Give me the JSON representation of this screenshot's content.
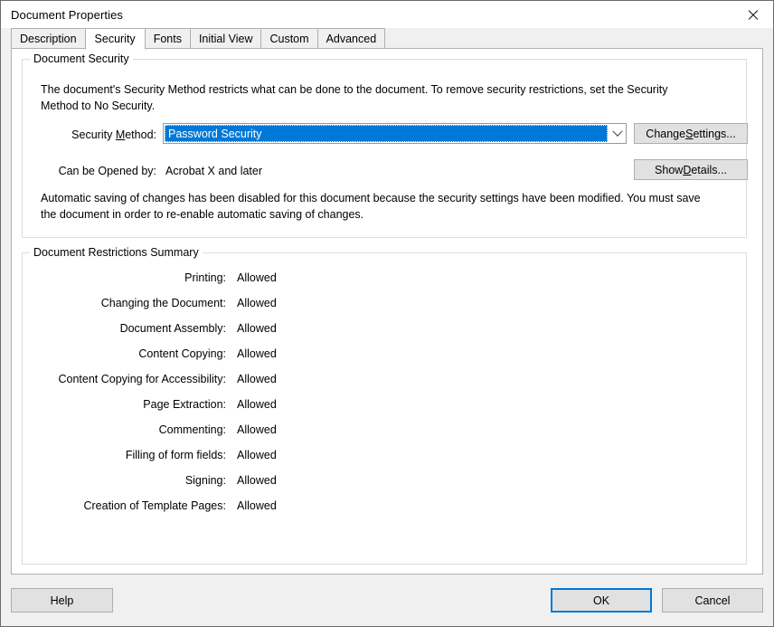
{
  "window": {
    "title": "Document Properties",
    "close_icon": "close-icon"
  },
  "tabs": [
    {
      "label": "Description",
      "selected": false
    },
    {
      "label": "Security",
      "selected": true
    },
    {
      "label": "Fonts",
      "selected": false
    },
    {
      "label": "Initial View",
      "selected": false
    },
    {
      "label": "Custom",
      "selected": false
    },
    {
      "label": "Advanced",
      "selected": false
    }
  ],
  "document_security": {
    "group_label": "Document Security",
    "description": "The document's Security Method restricts what can be done to the document. To remove security restrictions, set the Security Method to No Security.",
    "security_method_label": "Security Method:",
    "security_method_accel": "M",
    "security_method_value": "Password Security",
    "opened_by_label": "Can be Opened by:",
    "opened_by_value": "Acrobat X and later",
    "autosave_note": "Automatic saving of changes has been disabled for this document because the security settings have been modified. You must save the document in order to re-enable automatic saving of changes.",
    "change_settings_label": "Change Settings...",
    "change_settings_accel": "S",
    "show_details_label": "Show Details...",
    "show_details_accel": "D",
    "dropdown_icon": "chevron-down-icon"
  },
  "restrictions": {
    "group_label": "Document Restrictions Summary",
    "rows": [
      {
        "label": "Printing:",
        "value": "Allowed"
      },
      {
        "label": "Changing the Document:",
        "value": "Allowed"
      },
      {
        "label": "Document Assembly:",
        "value": "Allowed"
      },
      {
        "label": "Content Copying:",
        "value": "Allowed"
      },
      {
        "label": "Content Copying for Accessibility:",
        "value": "Allowed"
      },
      {
        "label": "Page Extraction:",
        "value": "Allowed"
      },
      {
        "label": "Commenting:",
        "value": "Allowed"
      },
      {
        "label": "Filling of form fields:",
        "value": "Allowed"
      },
      {
        "label": "Signing:",
        "value": "Allowed"
      },
      {
        "label": "Creation of Template Pages:",
        "value": "Allowed"
      }
    ]
  },
  "footer": {
    "help_label": "Help",
    "ok_label": "OK",
    "cancel_label": "Cancel"
  },
  "colors": {
    "selection_blue": "#0078d7",
    "dialog_face": "#f0f0f0",
    "button_face": "#e1e1e1",
    "group_border": "#dcdcdc"
  }
}
